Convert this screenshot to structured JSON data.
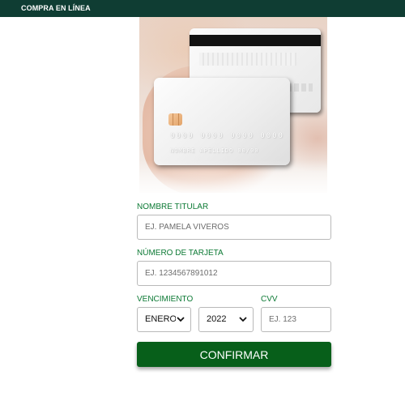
{
  "header": {
    "title": "COMPRA EN LÍNEA"
  },
  "hero": {
    "card_number_text": "0000 0000 0000 0000",
    "card_name_text": "NOMBRE APELLIDO  00/00"
  },
  "form": {
    "holder_name": {
      "label": "NOMBRE TITULAR",
      "placeholder": "EJ. PAMELA VIVEROS"
    },
    "card_number": {
      "label": "NÚMERO DE TARJETA",
      "placeholder": "EJ. 1234567891012"
    },
    "expiry": {
      "label": "VENCIMIENTO",
      "month_value": "ENERO",
      "year_value": "2022"
    },
    "cvv": {
      "label": "CVV",
      "placeholder": "EJ. 123"
    },
    "confirm_label": "CONFIRMAR"
  },
  "colors": {
    "header_bg": "#0f3d33",
    "label_green": "#0d7a35",
    "button_green": "#075f1a"
  }
}
